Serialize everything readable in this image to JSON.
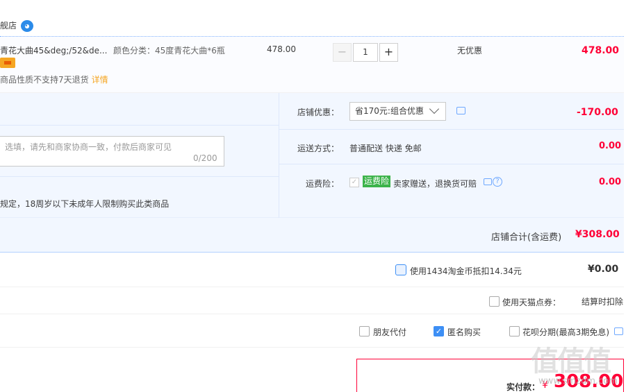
{
  "store": {
    "name": "舰店",
    "wangwang_icon": "wangwang-chat-icon"
  },
  "item": {
    "title": "青花大曲45&deg;/52&de...",
    "sku": "颜色分类：45度青花大曲*6瓶",
    "return_note": "商品性质不支持7天退货",
    "return_link": "详情",
    "unit_price": "478.00",
    "qty_minus": "−",
    "quantity": "1",
    "qty_plus": "+",
    "discount": "无优惠",
    "subtotal": "478.00"
  },
  "options": {
    "memo_placeholder": "选填，请先和商家协商一致，付款后商家可见",
    "memo_count": "0/200",
    "age_note": "规定，18周岁以下未成年人限制购买此类商品",
    "shop_discount_label": "店铺优惠：",
    "shop_discount_selected": "省170元:组合优惠",
    "shop_discount_amount": "-170.00",
    "shipping_label": "运送方式：",
    "shipping_method": "普通配送 快递 免邮",
    "shipping_amount": "0.00",
    "insurance_label": "运费险：",
    "insurance_check": "✓",
    "insurance_tag": "运费险",
    "insurance_desc": "卖家赠送，退换货可赔",
    "insurance_help": "?",
    "insurance_amount": "0.00"
  },
  "shop_total": {
    "label": "店铺合计(含运费)",
    "amount": "¥308.00"
  },
  "coins": {
    "label": "使用1434淘金币抵扣14.34元",
    "amount": "¥0.00"
  },
  "tmall_points": {
    "label": "使用天猫点券：",
    "value": "结算时扣除"
  },
  "extras": {
    "friend_pay": "朋友代付",
    "anonymous": "匿名购买",
    "anonymous_check": "✓",
    "huabei": "花呗分期(最高3期免息)"
  },
  "payment": {
    "label": "实付款：",
    "currency": "¥",
    "amount": "308.00"
  },
  "watermark": {
    "main": "值值值",
    "sub": "www.smzdm.com"
  },
  "colors": {
    "price_red": "#ff0036",
    "link_orange": "#f5a623",
    "accent_blue": "#3d8ff5",
    "panel_bg": "#f2f7ff"
  }
}
